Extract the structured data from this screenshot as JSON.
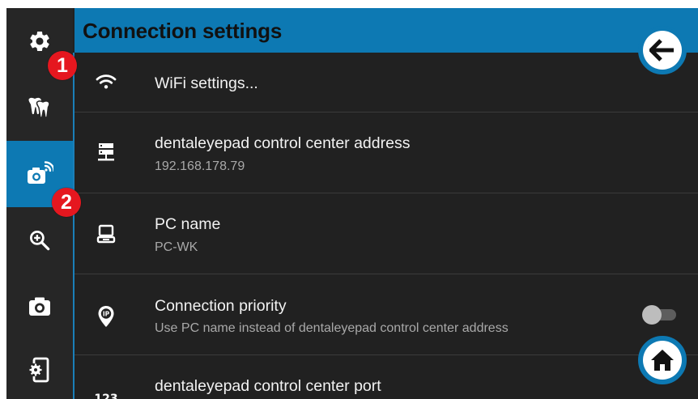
{
  "header": {
    "title": "Connection settings"
  },
  "sidebar": {
    "items": [
      {
        "icon": "gear-icon",
        "active": false
      },
      {
        "icon": "teeth-icon",
        "active": false
      },
      {
        "icon": "camera-wifi-icon",
        "active": true
      },
      {
        "icon": "zoom-in-icon",
        "active": false
      },
      {
        "icon": "camera-icon",
        "active": false
      },
      {
        "icon": "device-settings-icon",
        "active": false
      }
    ]
  },
  "markers": [
    "1",
    "2"
  ],
  "settings": [
    {
      "icon": "wifi-icon",
      "title": "WiFi settings...",
      "subtitle": ""
    },
    {
      "icon": "server-icon",
      "title": "dentaleyepad control center address",
      "subtitle": "192.168.178.79"
    },
    {
      "icon": "computer-icon",
      "title": "PC name",
      "subtitle": "PC-WK"
    },
    {
      "icon": "ip-location-icon",
      "title": "Connection priority",
      "subtitle": "Use PC name instead of dentaleyepad control center address",
      "toggle": false
    },
    {
      "icon": "numeric-123-icon",
      "title": "dentaleyepad control center port",
      "subtitle": ""
    }
  ],
  "icon_text": {
    "numeric": "123"
  },
  "buttons": {
    "back": "arrow-left-icon",
    "home": "home-icon"
  },
  "colors": {
    "accent": "#0d79b3",
    "background": "#212121",
    "marker": "#e5171f"
  }
}
